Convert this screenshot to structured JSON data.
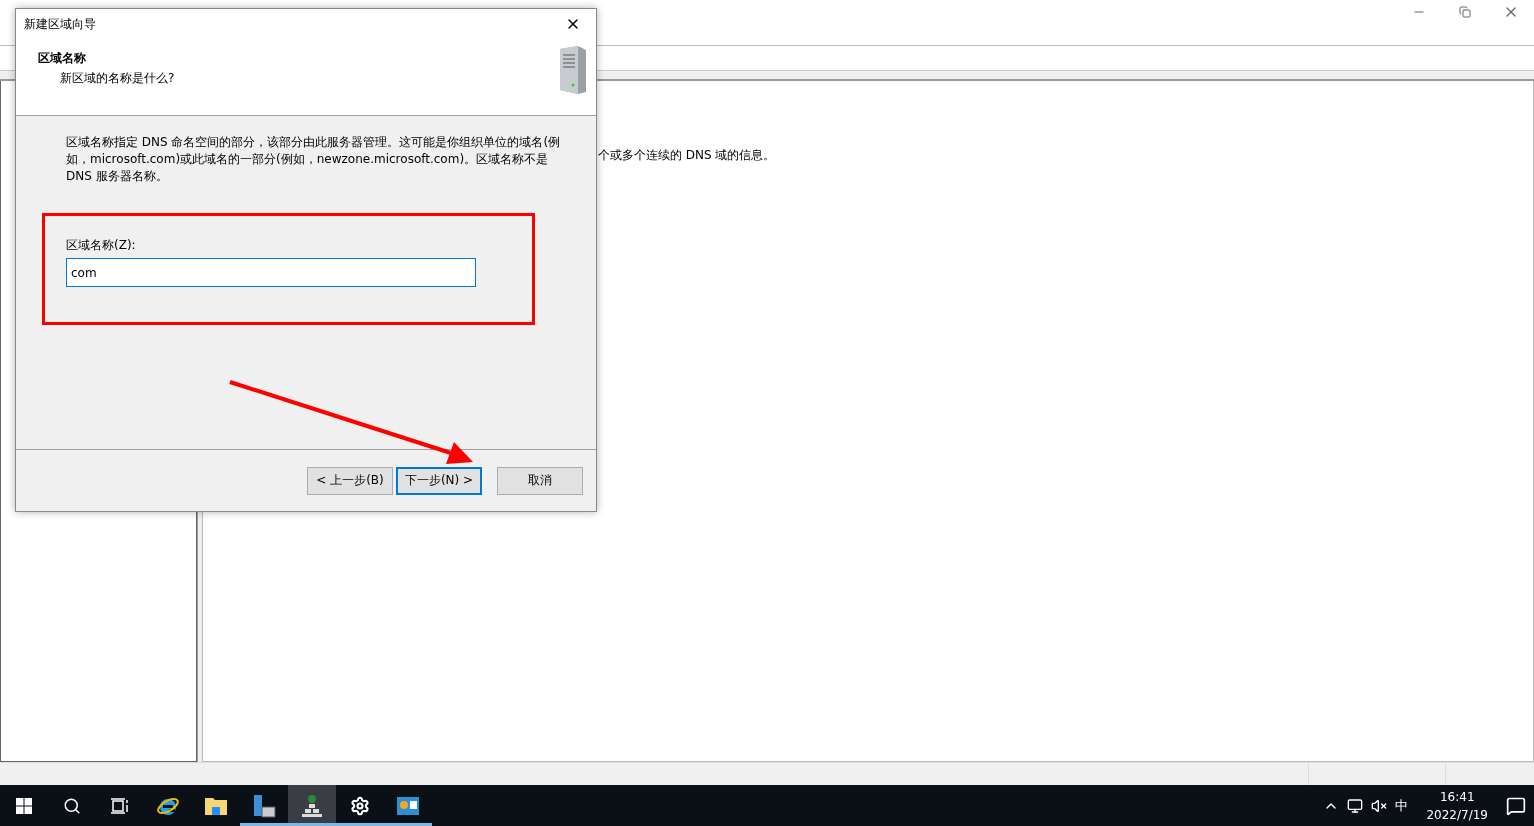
{
  "background_window": {
    "content_text": "个或多个连续的 DNS 域的信息。"
  },
  "dialog": {
    "title": "新建区域向导",
    "header": {
      "title": "区域名称",
      "subtitle": "新区域的名称是什么?"
    },
    "description": "区域名称指定 DNS 命名空间的部分，该部分由此服务器管理。这可能是你组织单位的域名(例如，microsoft.com)或此域名的一部分(例如，newzone.microsoft.com)。区域名称不是 DNS 服务器名称。",
    "field": {
      "label": "区域名称(Z):",
      "value": "com"
    },
    "buttons": [
      {
        "label": "< 上一步(B)",
        "focused": false
      },
      {
        "label": "下一步(N) >",
        "focused": true
      },
      {
        "label": "取消",
        "focused": false
      }
    ]
  },
  "taskbar": {
    "apps": [
      {
        "kind": "ie",
        "running": false,
        "selected": false
      },
      {
        "kind": "explorer",
        "running": false,
        "selected": false
      },
      {
        "kind": "server",
        "running": true,
        "selected": false
      },
      {
        "kind": "dns",
        "running": true,
        "selected": true
      },
      {
        "kind": "settings",
        "running": true,
        "selected": false
      },
      {
        "kind": "panel",
        "running": true,
        "selected": false
      }
    ],
    "tray": {
      "ime": "中",
      "time": "16:41",
      "date": "2022/7/19"
    }
  }
}
